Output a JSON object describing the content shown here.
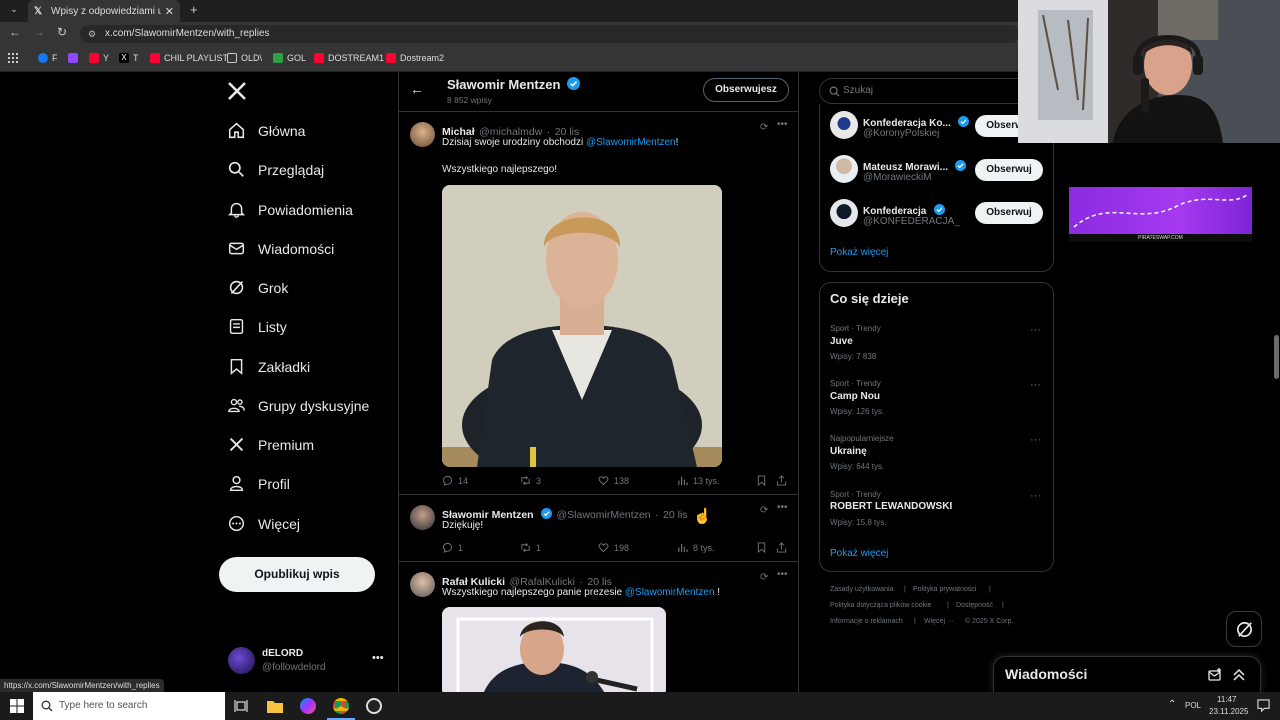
{
  "browser": {
    "tab_title": "Wpisy z odpowiedziami użytko",
    "url": "x.com/SlawomirMentzen/with_replies",
    "status_url": "https://x.com/SlawomirMentzen/with_replies",
    "bookmarks": [
      "F",
      "Y",
      "T",
      "CHIL PLAYLIST",
      "OLD\\",
      "GOL",
      "DOSTREAM1",
      "Dostream2"
    ]
  },
  "nav": {
    "items": [
      {
        "label": "Główna",
        "icon": "home-icon"
      },
      {
        "label": "Przeglądaj",
        "icon": "search-icon"
      },
      {
        "label": "Powiadomienia",
        "icon": "bell-icon"
      },
      {
        "label": "Wiadomości",
        "icon": "mail-icon"
      },
      {
        "label": "Grok",
        "icon": "grok-icon"
      },
      {
        "label": "Listy",
        "icon": "list-icon"
      },
      {
        "label": "Zakładki",
        "icon": "bookmark-icon"
      },
      {
        "label": "Grupy dyskusyjne",
        "icon": "people-icon"
      },
      {
        "label": "Premium",
        "icon": "x-icon"
      },
      {
        "label": "Profil",
        "icon": "person-icon"
      },
      {
        "label": "Więcej",
        "icon": "more-circle-icon"
      }
    ],
    "post_button": "Opublikuj wpis",
    "account": {
      "name": "dELORD",
      "handle": "@followdelord"
    }
  },
  "profile_header": {
    "name": "Sławomir Mentzen",
    "posts_count": "8 852 wpisy",
    "follow_state": "Obserwujesz"
  },
  "tweets": [
    {
      "name": "Michał",
      "handle": "@michalmdw",
      "date": "20 lis",
      "text": "Dzisiaj swoje urodziny obchodzi",
      "mention": "@SlawomirMentzen",
      "text_suffix": "!",
      "line2": "Wszystkiego najlepszego!",
      "replies": "14",
      "reposts": "3",
      "likes": "138",
      "views": "13 tys."
    },
    {
      "name": "Sławomir Mentzen",
      "handle": "@SlawomirMentzen",
      "date": "20 lis",
      "text": "Dziękuję!",
      "replies": "1",
      "reposts": "1",
      "likes": "198",
      "views": "8 tys."
    },
    {
      "name": "Rafał Kulicki",
      "handle": "@RafalKulicki",
      "date": "20 lis",
      "text": "Wszystkiego najlepszego panie prezesie",
      "mention": "@SlawomirMentzen",
      "text_suffix": "!"
    }
  ],
  "search": {
    "placeholder": "Szukaj"
  },
  "who_to_follow": {
    "accounts": [
      {
        "name": "Konfederacja Ko...",
        "handle": "@KoronyPolskiej",
        "button": "Obserwuj"
      },
      {
        "name": "Mateusz Morawi...",
        "handle": "@MorawieckiM",
        "button": "Obserwuj"
      },
      {
        "name": "Konfederacja",
        "handle": "@KONFEDERACJA_",
        "button": "Obserwuj"
      }
    ],
    "show_more": "Pokaż więcej"
  },
  "trends": {
    "title": "Co się dzieje",
    "items": [
      {
        "category": "Sport · Trendy",
        "name": "Juve",
        "count": "Wpisy: 7 838"
      },
      {
        "category": "Sport · Trendy",
        "name": "Camp Nou",
        "count": "Wpisy: 126 tys."
      },
      {
        "category": "Najpopularniejsze",
        "name": "Ukrainę",
        "count": "Wpisy: 644 tys."
      },
      {
        "category": "Sport · Trendy",
        "name": "ROBERT LEWANDOWSKI",
        "count": "Wpisy: 15,8 tys."
      }
    ],
    "show_more": "Pokaż więcej"
  },
  "footer": {
    "links": [
      "Zasady użytkowania",
      "Polityka prywatności",
      "Polityka dotycząca plików cookie",
      "Dostępność",
      "Informacje o reklamach",
      "Więcej ···",
      "© 2025 X Corp."
    ]
  },
  "ad_banner": {
    "text": "PIRATESWAP.COM"
  },
  "messages_drawer": {
    "title": "Wiadomości"
  },
  "taskbar": {
    "search_placeholder": "Type here to search",
    "lang": "POL",
    "time": "11:47",
    "date": "23.11.2025"
  },
  "colors": {
    "accent": "#1d9bf0",
    "bg": "#000000",
    "border": "#2f3336",
    "muted": "#71767b"
  }
}
